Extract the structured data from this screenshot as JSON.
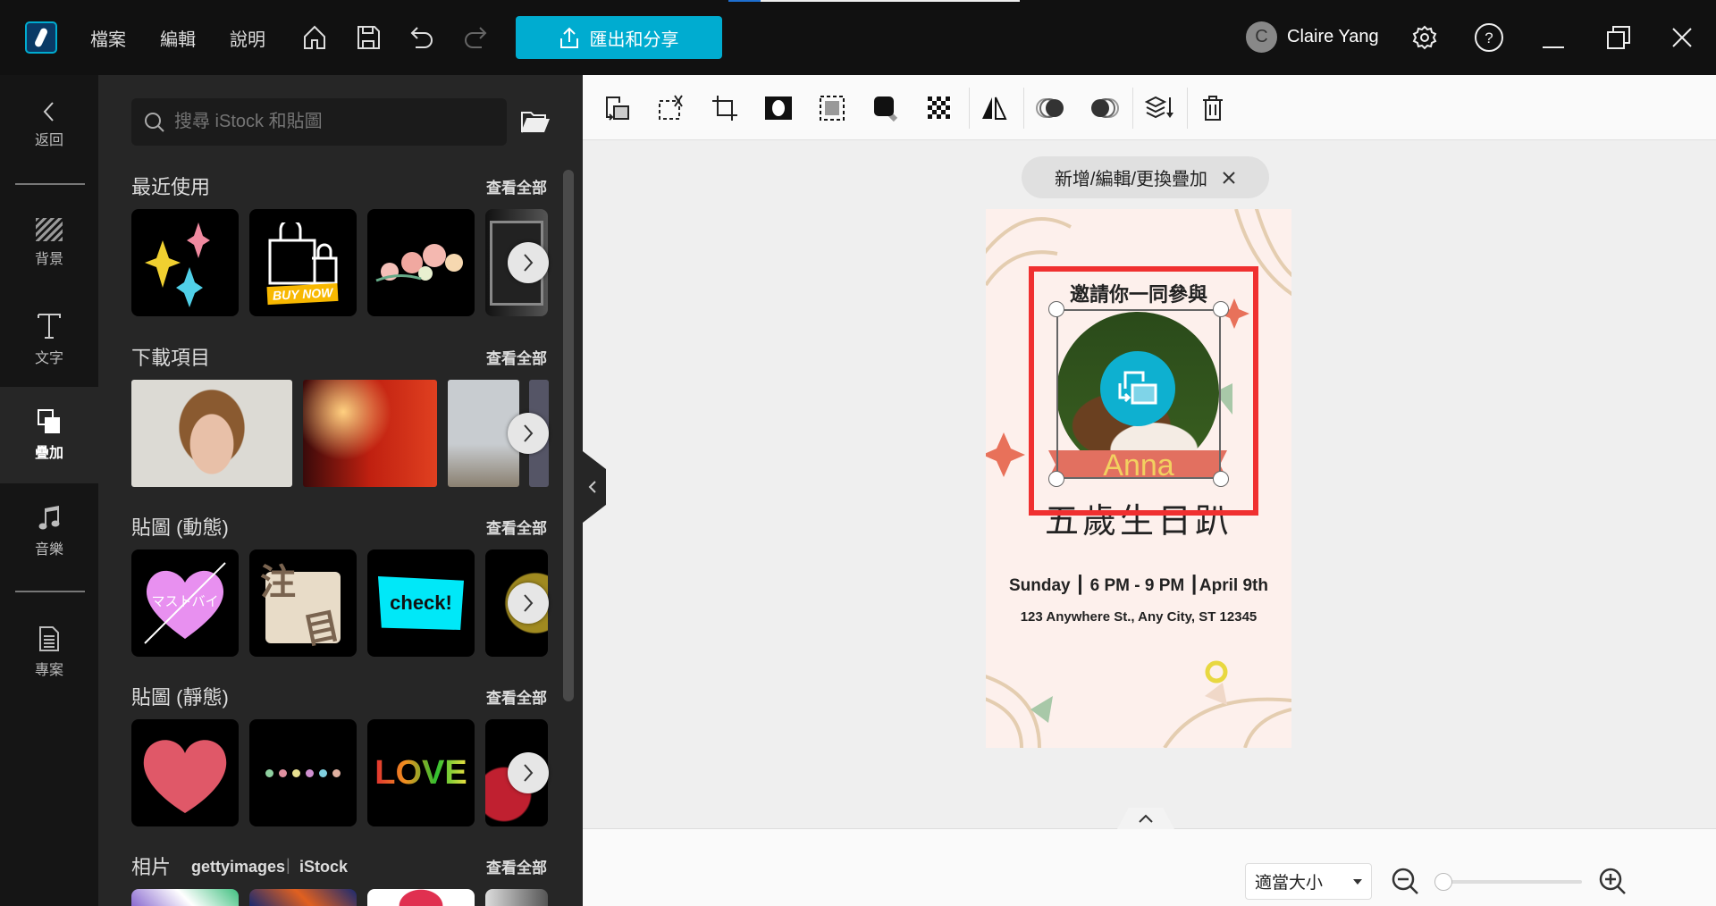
{
  "topbar": {
    "menus": [
      "檔案",
      "編輯",
      "說明"
    ],
    "export_label": "匯出和分享",
    "user": {
      "initial": "C",
      "name": "Claire Yang"
    }
  },
  "leftnav": {
    "items": [
      {
        "label": "返回",
        "icon": "chevron-left-icon"
      },
      {
        "label": "背景",
        "icon": "background-icon"
      },
      {
        "label": "文字",
        "icon": "text-icon"
      },
      {
        "label": "疊加",
        "icon": "overlay-icon",
        "selected": true
      },
      {
        "label": "音樂",
        "icon": "music-icon"
      },
      {
        "label": "專案",
        "icon": "project-icon"
      }
    ]
  },
  "panel": {
    "search_placeholder": "搜尋 iStock 和貼圖",
    "see_all": "查看全部",
    "sections": [
      {
        "title": "最近使用"
      },
      {
        "title": "下載項目"
      },
      {
        "title": "貼圖 (動態)"
      },
      {
        "title": "貼圖 (靜態)"
      },
      {
        "title": "相片",
        "brand1": "gettyimages",
        "brand2": "iStock"
      }
    ],
    "thumb_text": {
      "buy_now": "BUY NOW",
      "masutobai": "マストバイ",
      "chuumoku1": "注",
      "chuumoku2": "目",
      "check": "check!",
      "love": "LOVE"
    }
  },
  "canvas": {
    "hint": "新增/編輯/更換疊加",
    "doc": {
      "invite": "邀請你一同參與",
      "name": "Anna",
      "title": "五歲生日趴",
      "details": "Sunday ┃ 6 PM - 9 PM ┃April 9th",
      "address": "123 Anywhere St., Any City, ST 12345"
    },
    "accent": "#00acd0",
    "selection_color": "#f03030"
  },
  "bottom": {
    "fit_label": "適當大小",
    "zoom_fraction": 0.0
  }
}
